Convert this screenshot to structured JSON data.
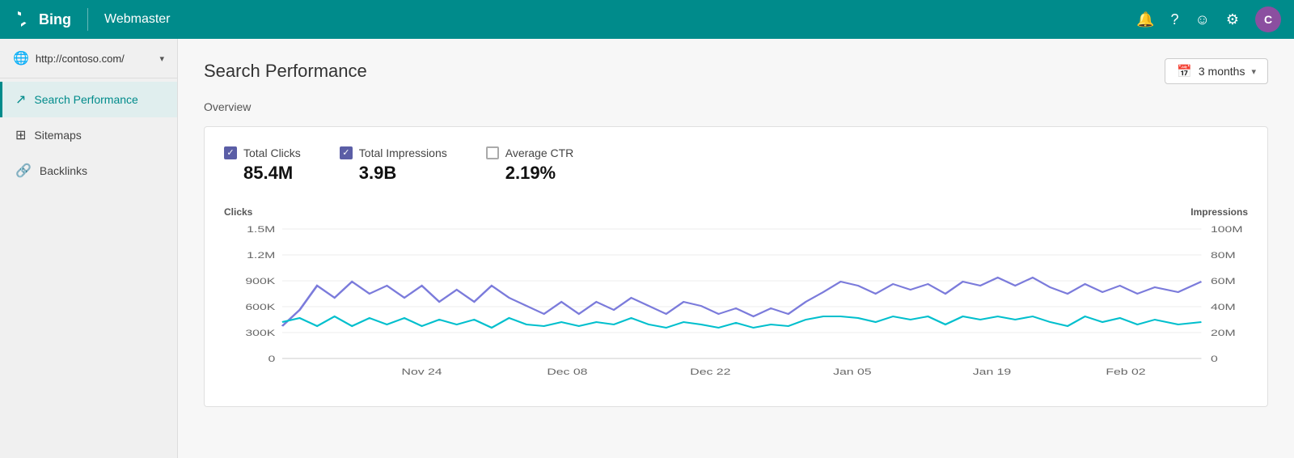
{
  "topnav": {
    "logo_text": "Bing",
    "app_name": "Webmaster",
    "icons": [
      "bell",
      "question",
      "smiley",
      "gear"
    ],
    "avatar_letter": "C",
    "avatar_color": "#8B4FA0"
  },
  "sidebar": {
    "url": "http://contoso.com/",
    "items": [
      {
        "id": "search-performance",
        "label": "Search Performance",
        "icon": "trending-up",
        "active": true
      },
      {
        "id": "sitemaps",
        "label": "Sitemaps",
        "icon": "sitemap",
        "active": false
      },
      {
        "id": "backlinks",
        "label": "Backlinks",
        "icon": "link",
        "active": false
      }
    ]
  },
  "main": {
    "page_title": "Search Performance",
    "overview_label": "Overview",
    "date_filter": {
      "label": "3 months",
      "icon": "calendar"
    },
    "metrics": [
      {
        "id": "total-clicks",
        "label": "Total Clicks",
        "value": "85.4M",
        "checked": true
      },
      {
        "id": "total-impressions",
        "label": "Total Impressions",
        "value": "3.9B",
        "checked": true
      },
      {
        "id": "average-ctr",
        "label": "Average CTR",
        "value": "2.19%",
        "checked": false
      }
    ],
    "chart": {
      "left_axis_label": "Clicks",
      "right_axis_label": "Impressions",
      "left_y_labels": [
        "1.5M",
        "1.2M",
        "900K",
        "600K",
        "300K",
        "0"
      ],
      "right_y_labels": [
        "100M",
        "80M",
        "60M",
        "40M",
        "20M",
        "0"
      ],
      "x_labels": [
        "Nov 24",
        "Dec 08",
        "Dec 22",
        "Jan 05",
        "Jan 19",
        "Feb 02"
      ],
      "series": [
        {
          "id": "clicks",
          "color": "#7B7BDB",
          "label": "Clicks"
        },
        {
          "id": "impressions",
          "color": "#00BFFF",
          "label": "Impressions"
        }
      ]
    }
  }
}
